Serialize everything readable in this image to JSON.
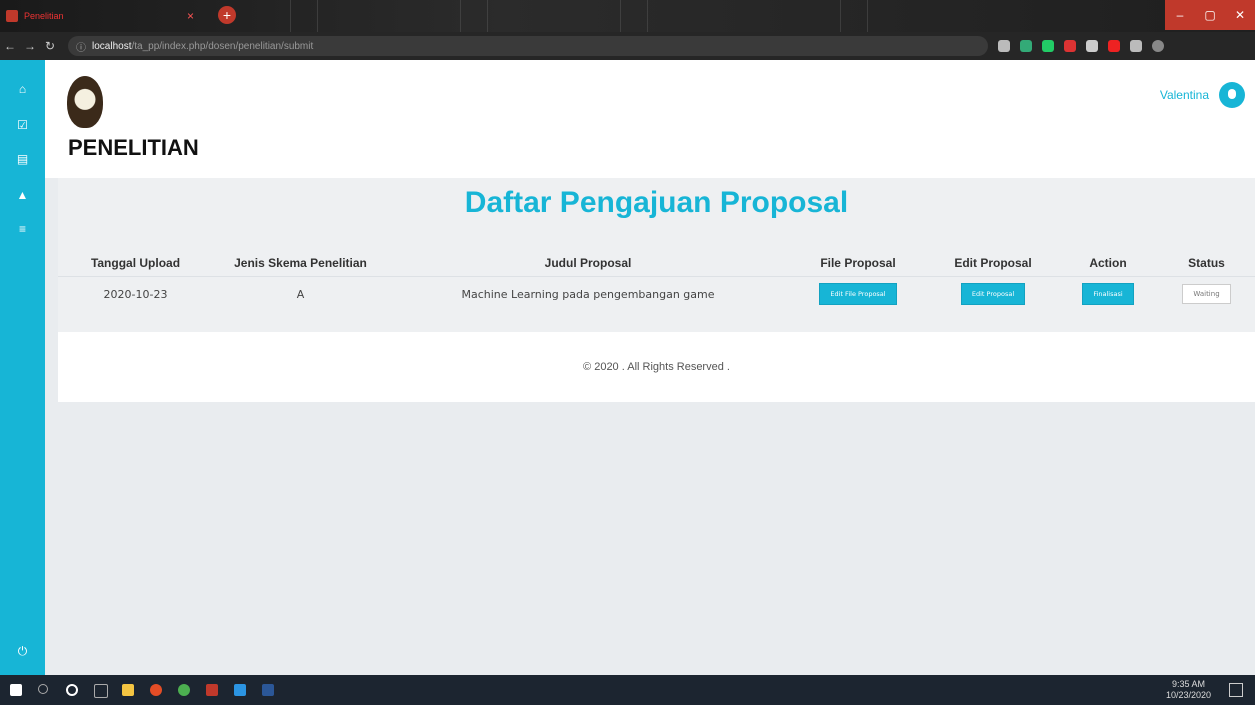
{
  "browser": {
    "tab_title": "Penelitian",
    "new_tab_symbol": "+",
    "url_host": "localhost",
    "url_path": "/ta_pp/index.php/dosen/penelitian/submit"
  },
  "header": {
    "page_heading": "PENELITIAN",
    "user_name": "Valentina"
  },
  "main": {
    "title": "Daftar Pengajuan Proposal",
    "table": {
      "headers": [
        "Tanggal Upload",
        "Jenis Skema Penelitian",
        "Judul Proposal",
        "File Proposal",
        "Edit Proposal",
        "Action",
        "Status"
      ],
      "rows": [
        {
          "tanggal": "2020-10-23",
          "skema": "A",
          "judul": "Machine Learning pada pengembangan game",
          "file_button": "Edit File Proposal",
          "edit_button": "Edit Proposal",
          "action_button": "Finalisasi",
          "status_button": "Waiting"
        }
      ]
    }
  },
  "footer": {
    "text": "© 2020 . All Rights Reserved ."
  },
  "taskbar": {
    "time": "9:35 AM",
    "date": "10/23/2020"
  },
  "colors": {
    "accent": "#17b5d6",
    "heading": "#111111"
  }
}
